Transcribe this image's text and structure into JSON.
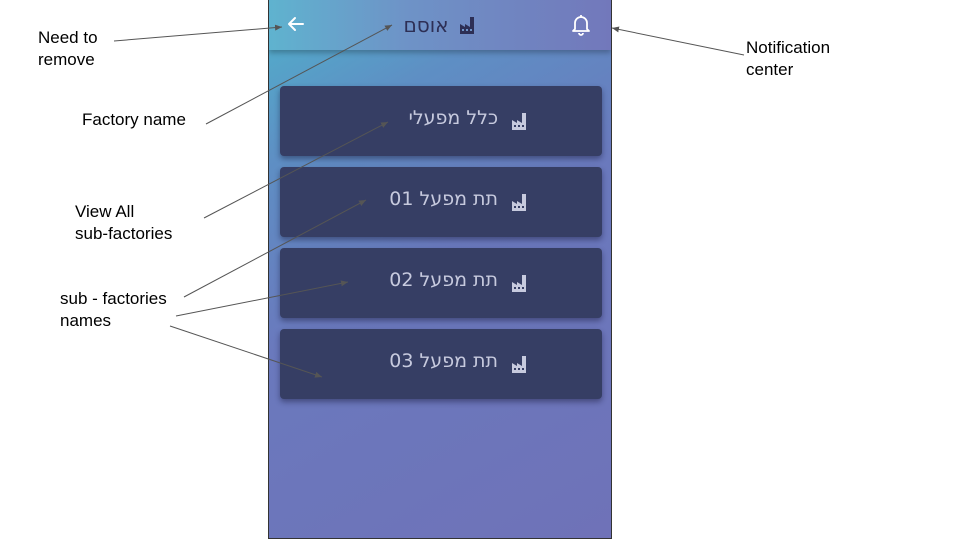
{
  "app": {
    "title": "אוסם",
    "back_icon": "arrow-left-icon",
    "title_icon": "factory-icon",
    "notification_icon": "bell-icon"
  },
  "cards": [
    {
      "label": "כלל מפעלי",
      "icon": "factory-icon"
    },
    {
      "label": "תת מפעל 01",
      "icon": "factory-icon"
    },
    {
      "label": "תת מפעל 02",
      "icon": "factory-icon"
    },
    {
      "label": "תת מפעל 03",
      "icon": "factory-icon"
    }
  ],
  "annotations": {
    "need_to_remove": "Need to\nremove",
    "factory_name": "Factory name",
    "view_all": "View All\nsub-factories",
    "sub_factories_names": "sub - factories\nnames",
    "notification_center": "Notification\ncenter"
  },
  "colors": {
    "card_bg": "#363e64",
    "card_text": "#c7cade",
    "title_text": "#2d2f55",
    "annotation_line": "#555555"
  }
}
